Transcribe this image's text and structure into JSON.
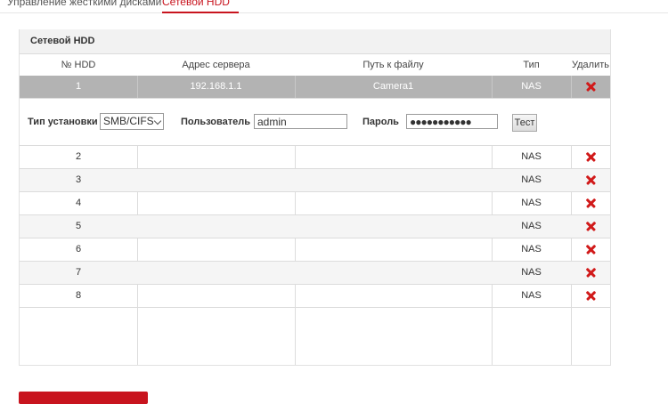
{
  "tabs": [
    {
      "label": "Управление жесткими дисками",
      "active": false
    },
    {
      "label": "Сетевой HDD",
      "active": true
    }
  ],
  "panel": {
    "title": "Сетевой HDD"
  },
  "table": {
    "headers": [
      "№ HDD",
      "Адрес сервера",
      "Путь к файлу",
      "Тип",
      "Удалить"
    ],
    "selected_row": {
      "num": "1",
      "server": "192.168.1.1",
      "path": "Camera1",
      "type": "NAS"
    },
    "rows": [
      {
        "num": "2",
        "server": "",
        "path": "",
        "type": "NAS"
      },
      {
        "num": "3",
        "server": "",
        "path": "",
        "type": "NAS"
      },
      {
        "num": "4",
        "server": "",
        "path": "",
        "type": "NAS"
      },
      {
        "num": "5",
        "server": "",
        "path": "",
        "type": "NAS"
      },
      {
        "num": "6",
        "server": "",
        "path": "",
        "type": "NAS"
      },
      {
        "num": "7",
        "server": "",
        "path": "",
        "type": "NAS"
      },
      {
        "num": "8",
        "server": "",
        "path": "",
        "type": "NAS"
      }
    ]
  },
  "config": {
    "mount_type_label": "Тип установки",
    "mount_type_value": "SMB/CIFS",
    "user_label": "Пользователь",
    "user_value": "admin",
    "password_label": "Пароль",
    "password_value": "●●●●●●●●●●●",
    "test_button": "Тест"
  },
  "colors": {
    "accent": "#c8141e",
    "selected_row": "#b3b3b3",
    "delete_icon": "#d11a1a"
  }
}
